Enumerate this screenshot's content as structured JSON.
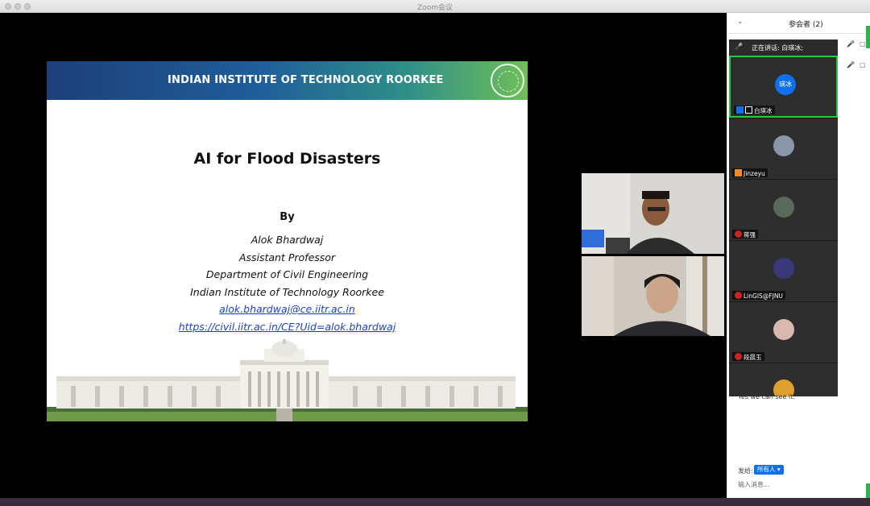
{
  "window": {
    "title": "Zoom会议"
  },
  "slide": {
    "header": "INDIAN INSTITUTE OF TECHNOLOGY ROORKEE",
    "title": "AI for Flood Disasters",
    "by": "By",
    "author": "Alok Bhardwaj",
    "position": "Assistant Professor",
    "department": "Department of Civil Engineering",
    "institute": "Indian Institute of Technology Roorkee",
    "email": "alok.bhardwaj@ce.iitr.ac.in",
    "url": "https://civil.iitr.ac.in/CE?Uid=alok.bhardwaj"
  },
  "panel": {
    "title": "参会者 (2)"
  },
  "gallery": {
    "speaking": "正在讲话: 白瑛冰;",
    "tiles": [
      {
        "name": "白瑛冰",
        "avatar": "瑛冰",
        "avatar_color": "#0e71eb"
      },
      {
        "name": "Jinzeyu",
        "avatar": "",
        "avatar_color": "#8a97a8"
      },
      {
        "name": "蒋强",
        "avatar": "",
        "avatar_color": "#5a6a5a"
      },
      {
        "name": "LinGIS@FJNU",
        "avatar": "",
        "avatar_color": "#3a3a7a"
      },
      {
        "name": "段晨玉",
        "avatar": "",
        "avatar_color": "#d9b8b0"
      }
    ]
  },
  "chat": {
    "message": "Yes we can see  it.",
    "to_label": "发给:",
    "to_value": "所有人",
    "input_placeholder": "输入消息..."
  }
}
